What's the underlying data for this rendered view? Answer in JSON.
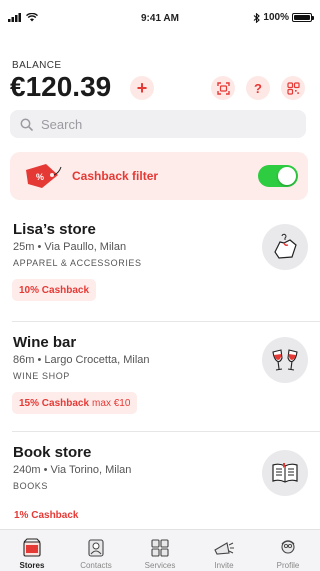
{
  "status_bar": {
    "time": "9:41 AM",
    "battery_text": "100%",
    "battery_level": 1.0
  },
  "balance": {
    "label": "BALANCE",
    "amount": "€120.39",
    "add_label": "+",
    "help_label": "?"
  },
  "search": {
    "placeholder": "Search",
    "value": ""
  },
  "filter": {
    "label": "Cashback filter",
    "enabled": true
  },
  "stores": [
    {
      "name": "Lisa’s store",
      "meta": "25m • Via Paullo, Milan",
      "category": "APPAREL & ACCESSORIES",
      "cashback": "10% Cashback",
      "cashback_extra": "",
      "icon": "shirt-icon"
    },
    {
      "name": "Wine bar",
      "meta": "86m • Largo Crocetta, Milan",
      "category": "WINE SHOP",
      "cashback": "15% Cashback",
      "cashback_extra": "max €10",
      "icon": "wine-glasses-icon"
    },
    {
      "name": "Book store",
      "meta": "240m • Via Torino, Milan",
      "category": "BOOKS",
      "cashback": "1% Cashback",
      "cashback_extra": "",
      "icon": "book-icon"
    }
  ],
  "tabs": [
    {
      "label": "Stores",
      "icon": "store-icon",
      "active": true
    },
    {
      "label": "Contacts",
      "icon": "contacts-icon",
      "active": false
    },
    {
      "label": "Services",
      "icon": "services-icon",
      "active": false
    },
    {
      "label": "Invite",
      "icon": "megaphone-icon",
      "active": false
    },
    {
      "label": "Profile",
      "icon": "profile-icon",
      "active": false
    }
  ],
  "colors": {
    "accent": "#e53935",
    "accent_light": "#fdecea",
    "toggle_on": "#2ecc40"
  }
}
